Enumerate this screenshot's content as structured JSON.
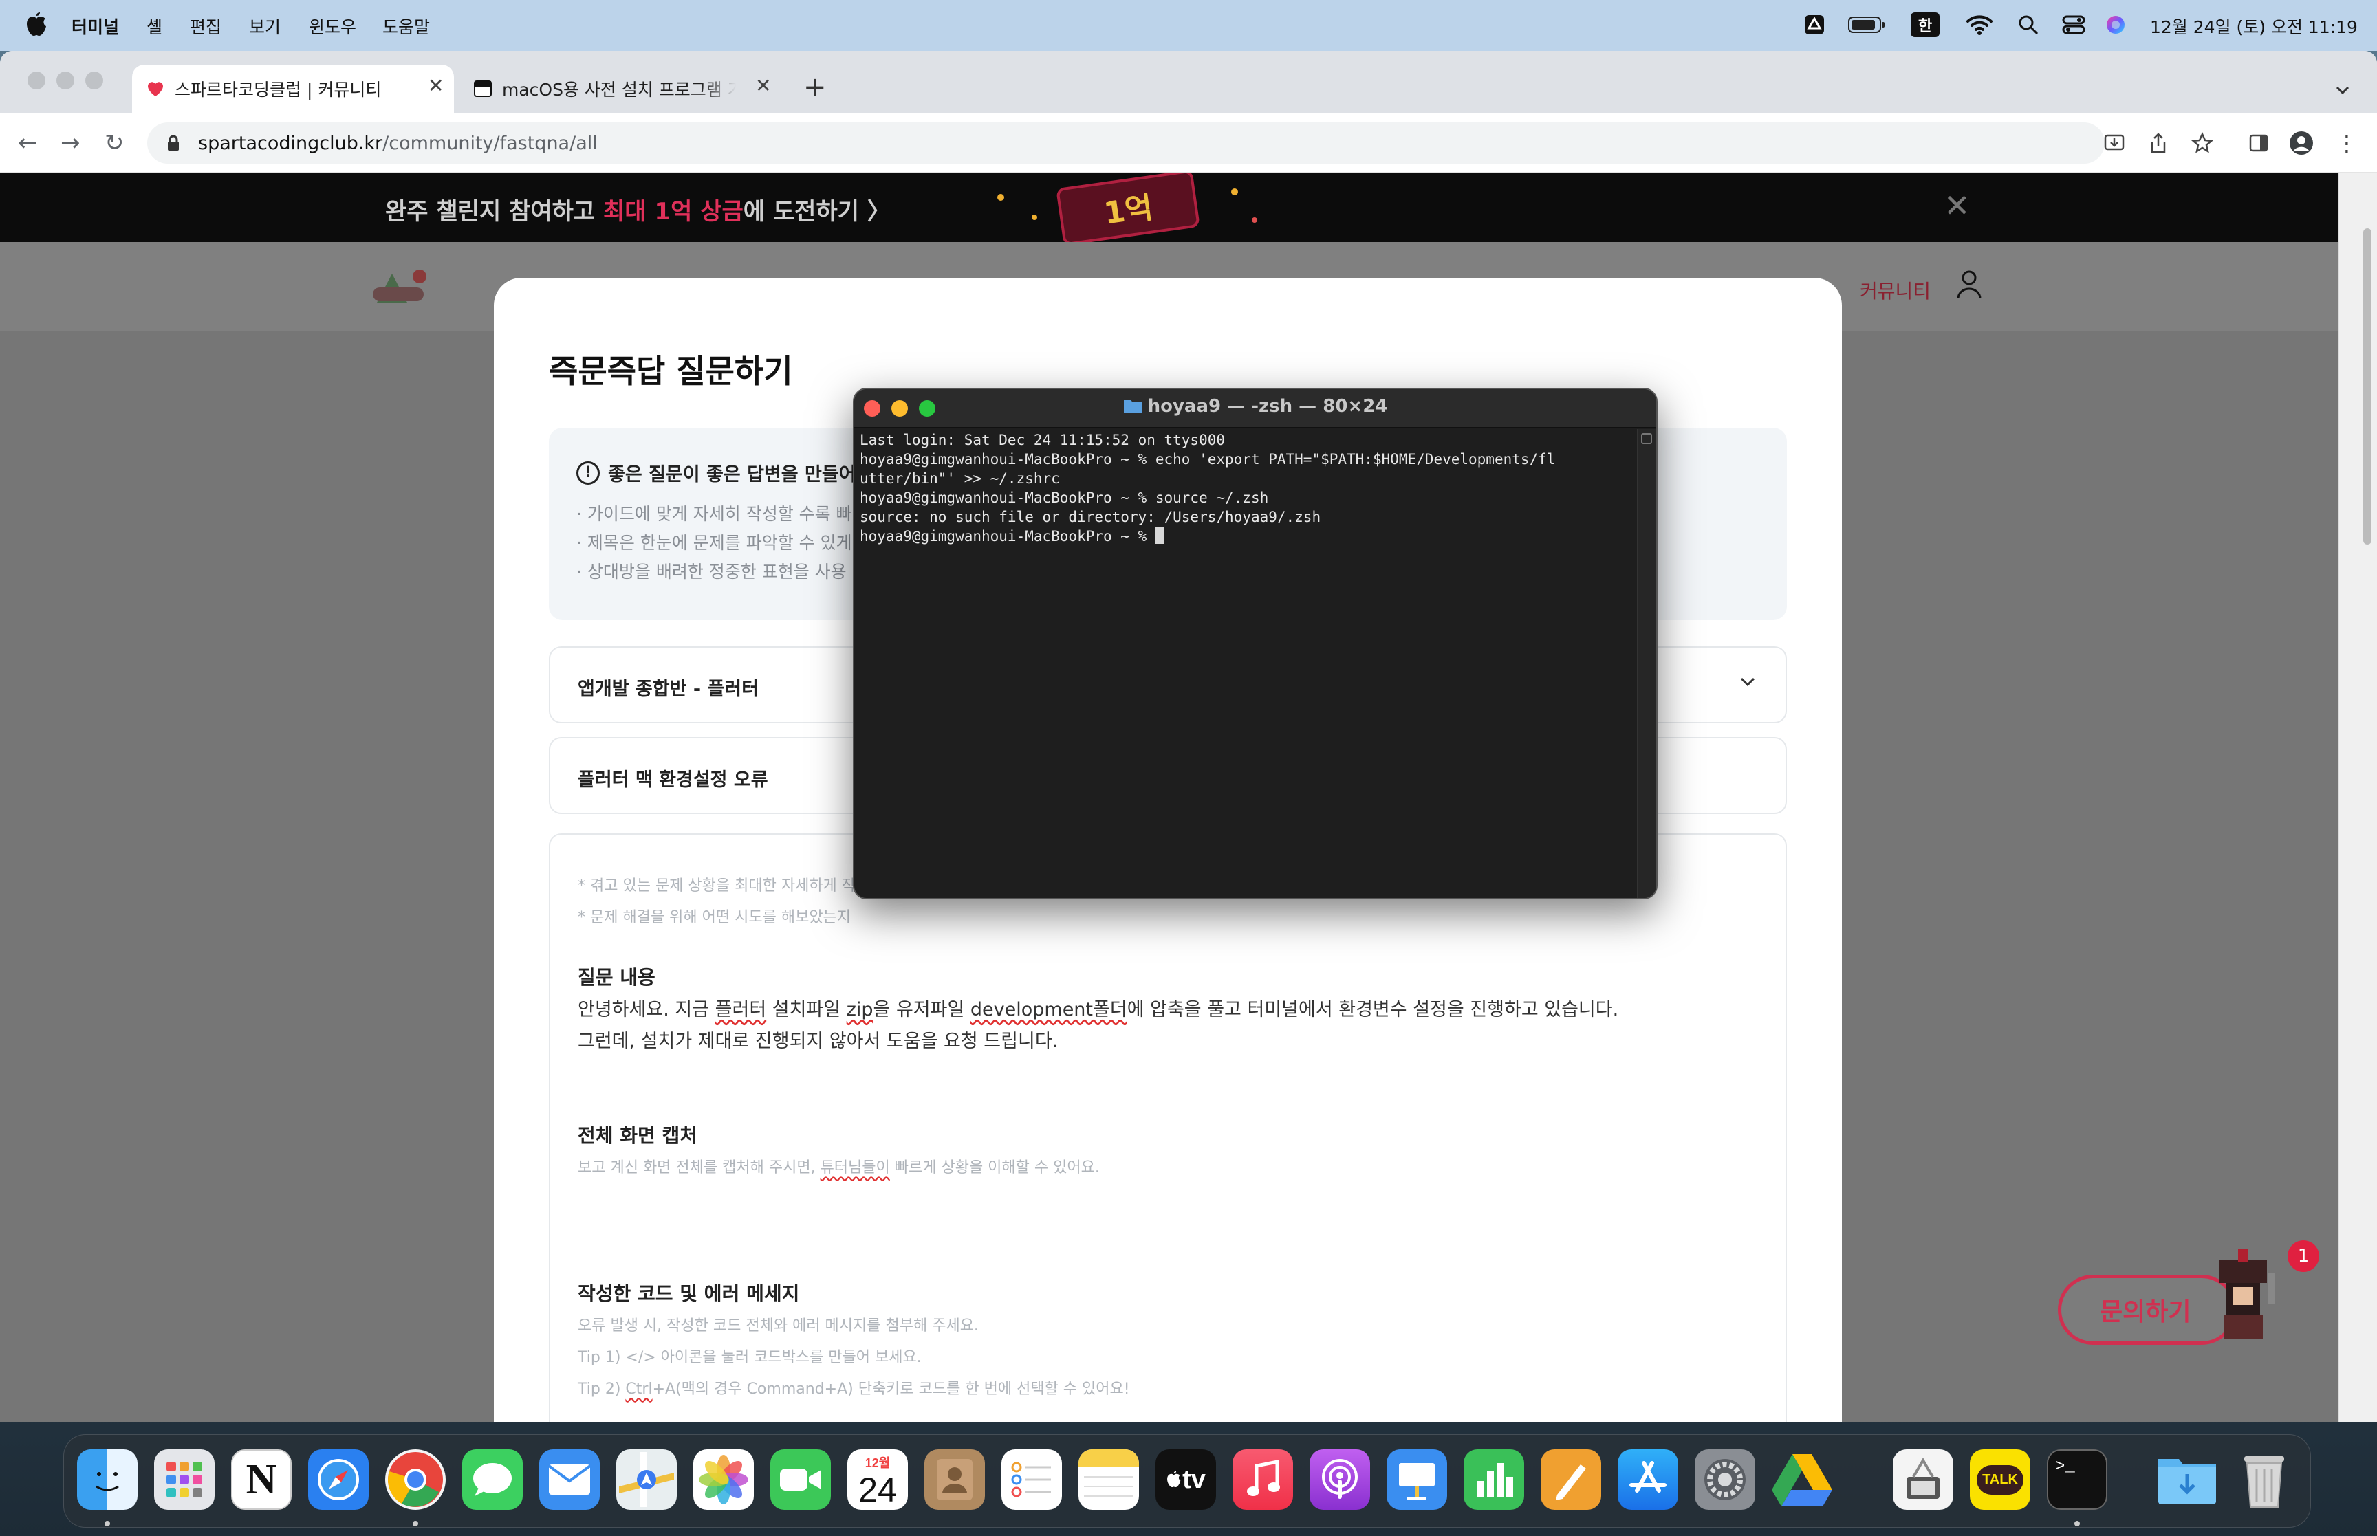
{
  "menubar": {
    "app_name": "터미널",
    "items": [
      "셸",
      "편집",
      "보기",
      "윈도우",
      "도움말"
    ],
    "input_method": "한",
    "clock": "12월 24일 (토) 오전 11:19"
  },
  "browser": {
    "tabs": [
      {
        "title": "스파르타코딩클럽 | 커뮤니티",
        "active": true
      },
      {
        "title": "macOS용 사전 설치 프로그램 가이드",
        "active": false
      }
    ],
    "new_tab_label": "+",
    "url_domain": "spartacodingclub.kr",
    "url_path": "/community/fastqna/all"
  },
  "page": {
    "banner_text_prefix": "완주 챌린지 참여하고 ",
    "banner_text_highlight": "최대 1억 상금",
    "banner_text_suffix": "에 도전하기 〉",
    "banner_badge": "1억",
    "nav_community": "커뮤니티",
    "inquiry_button": "문의하기",
    "inquiry_badge": "1"
  },
  "modal": {
    "title": "즉문즉답 질문하기",
    "guide": {
      "heading": "좋은 질문이 좋은 답변을 만들어요",
      "items": [
        "· 가이드에 맞게 자세히 작성할 수록 빠",
        "· 제목은 한눈에 문제를 파악할 수 있게",
        "· 상대방을 배려한 정중한 표현을 사용"
      ]
    },
    "course_select": "앱개발 종합반 - 플러터",
    "title_field": "플러터 맥 환경설정 오류",
    "editor": {
      "hint_1": "* 겪고 있는 문제 상황을 최대한 자세하게 작",
      "hint_2": "* 문제 해결을 위해 어떤 시도를 해보았는지",
      "q_heading": "질문 내용",
      "q_line1_a": "안녕하세요. 지금 ",
      "q_line1_b": "플러터",
      "q_line1_c": " 설치파일 ",
      "q_line1_d": "zip",
      "q_line1_e": "을 유저파일 ",
      "q_line1_f": "development폴더",
      "q_line1_g": "에 압축을 풀고 터미널에서 환경변수 설정을 진행하고 있습니다.",
      "q_line2": "그런데, 설치가 제대로 진행되지 않아서 도움을 요청 드립니다.",
      "cap_heading": "전체 화면 캡처",
      "cap_hint_a": "보고 계신 화면 전체를 캡처해 주시면, ",
      "cap_hint_b": "튜터님들이",
      "cap_hint_c": " 빠르게 상황을 이해할 수 있어요.",
      "code_heading": "작성한 코드 및 에러 메세지",
      "code_hint_1": "오류 발생 시, 작성한 코드 전체와 에러 메시지를 첨부해 주세요.",
      "code_hint_2": "Tip 1) </> 아이콘을 눌러 코드박스를 만들어 보세요.",
      "code_hint_3_a": "Tip 2) ",
      "code_hint_3_b": "Ctrl",
      "code_hint_3_c": "+A(맥의 경우 Command+A) 단축키로 코드를 한 번에 선택할 수 있어요!"
    }
  },
  "terminal": {
    "title": "hoyaa9 — -zsh — 80×24",
    "lines": [
      "Last login: Sat Dec 24 11:15:52 on ttys000",
      "hoyaa9@gimgwanhoui-MacBookPro ~ % echo 'export PATH=\"$PATH:$HOME/Developments/fl",
      "utter/bin\"' >> ~/.zshrc",
      "hoyaa9@gimgwanhoui-MacBookPro ~ % source ~/.zsh",
      "source: no such file or directory: /Users/hoyaa9/.zsh",
      "hoyaa9@gimgwanhoui-MacBookPro ~ % "
    ]
  },
  "dock": {
    "calendar_month": "12월",
    "calendar_day": "24",
    "tv_label": "tv",
    "talk_label": "TALK",
    "terminal_prompt": ">_"
  }
}
